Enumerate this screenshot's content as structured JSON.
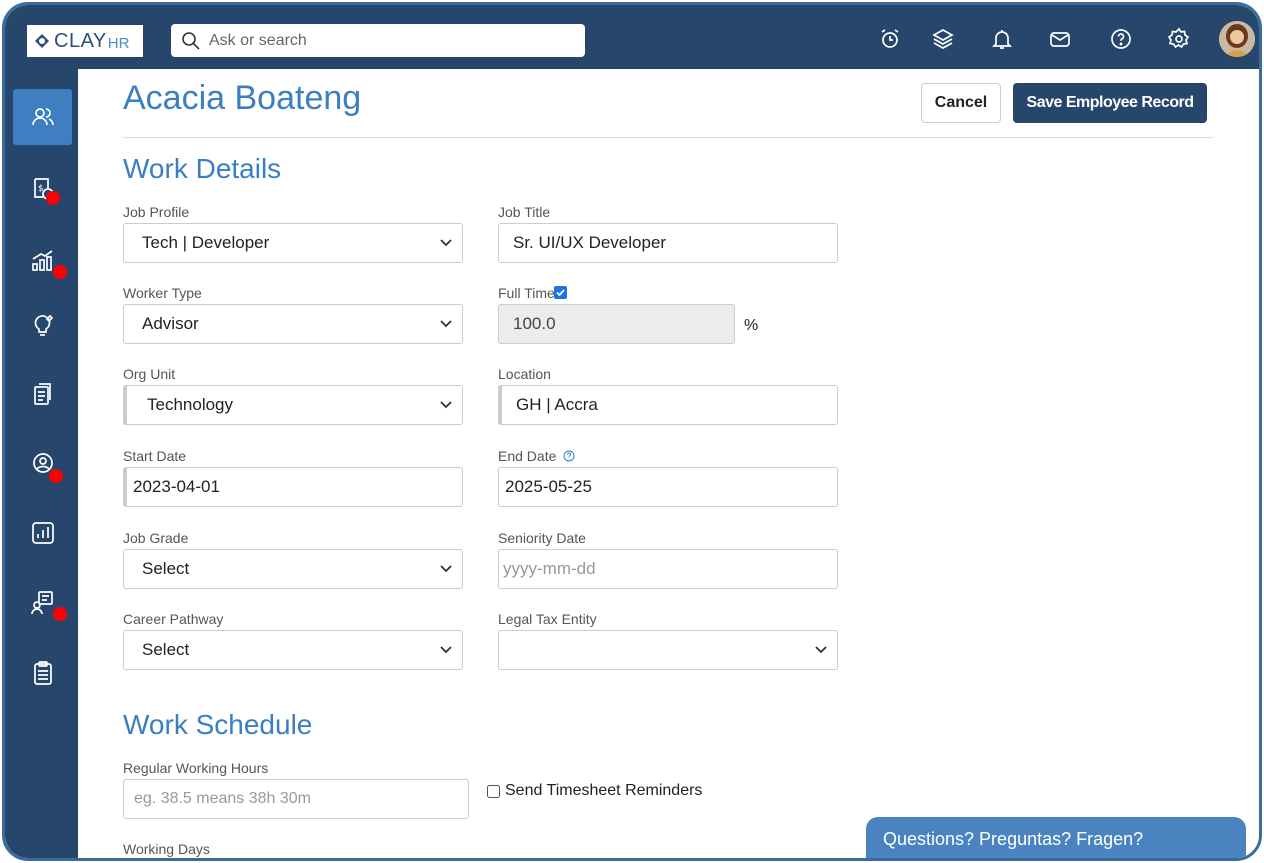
{
  "app": {
    "logo_text_1": "CLAY",
    "logo_text_2": "HR"
  },
  "search": {
    "placeholder": "Ask or search"
  },
  "topbar": {
    "icons": [
      "alarm-clock-icon",
      "layers-icon",
      "bell-icon",
      "mail-icon",
      "help-icon",
      "gear-icon",
      "user-avatar"
    ]
  },
  "sidebar": {
    "items": [
      {
        "name": "people-icon",
        "active": true,
        "badge": false
      },
      {
        "name": "payroll-icon",
        "active": false,
        "badge": true
      },
      {
        "name": "analytics-icon",
        "active": false,
        "badge": true
      },
      {
        "name": "ideas-icon",
        "active": false,
        "badge": false
      },
      {
        "name": "documents-icon",
        "active": false,
        "badge": false
      },
      {
        "name": "profile-icon",
        "active": false,
        "badge": true
      },
      {
        "name": "reports-icon",
        "active": false,
        "badge": false
      },
      {
        "name": "training-icon",
        "active": false,
        "badge": true
      },
      {
        "name": "clipboard-icon",
        "active": false,
        "badge": false
      }
    ]
  },
  "header": {
    "employee_name": "Acacia Boateng",
    "cancel_label": "Cancel",
    "save_label": "Save Employee Record"
  },
  "work_details": {
    "title": "Work Details",
    "job_profile": {
      "label": "Job Profile",
      "value": "Tech | Developer"
    },
    "job_title": {
      "label": "Job Title",
      "value": "Sr. UI/UX Developer"
    },
    "worker_type": {
      "label": "Worker Type",
      "value": "Advisor"
    },
    "full_time": {
      "label": "Full Time",
      "checked": true,
      "value": "100.0",
      "unit": "%"
    },
    "org_unit": {
      "label": "Org Unit",
      "value": "Technology"
    },
    "location": {
      "label": "Location",
      "value": "GH | Accra"
    },
    "start_date": {
      "label": "Start Date",
      "value": "2023-04-01"
    },
    "end_date": {
      "label": "End Date",
      "value": "2025-05-25"
    },
    "job_grade": {
      "label": "Job Grade",
      "value": "Select"
    },
    "seniority_date": {
      "label": "Seniority Date",
      "placeholder": "yyyy-mm-dd"
    },
    "career_pathway": {
      "label": "Career Pathway",
      "value": "Select"
    },
    "legal_tax_entity": {
      "label": "Legal Tax Entity",
      "value": ""
    }
  },
  "work_schedule": {
    "title": "Work Schedule",
    "regular_hours": {
      "label": "Regular Working Hours",
      "placeholder": "eg. 38.5 means 38h 30m"
    },
    "timesheet_reminders": {
      "label": "Send Timesheet Reminders",
      "checked": false
    },
    "working_days": {
      "label": "Working Days"
    }
  },
  "help_banner": {
    "text": "Questions? Preguntas? Fragen?"
  }
}
